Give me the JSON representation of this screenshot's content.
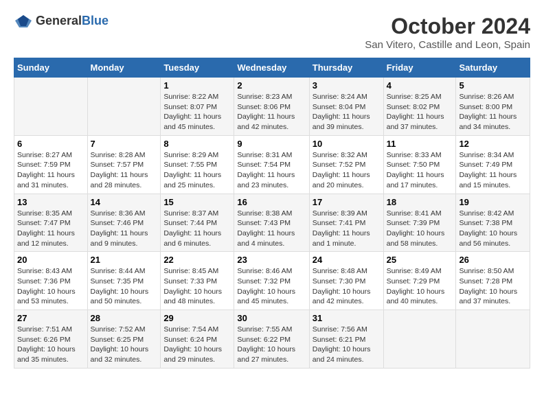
{
  "logo": {
    "text_general": "General",
    "text_blue": "Blue"
  },
  "title": "October 2024",
  "subtitle": "San Vitero, Castille and Leon, Spain",
  "days_of_week": [
    "Sunday",
    "Monday",
    "Tuesday",
    "Wednesday",
    "Thursday",
    "Friday",
    "Saturday"
  ],
  "weeks": [
    [
      {
        "day": "",
        "info": ""
      },
      {
        "day": "",
        "info": ""
      },
      {
        "day": "1",
        "info": "Sunrise: 8:22 AM\nSunset: 8:07 PM\nDaylight: 11 hours and 45 minutes."
      },
      {
        "day": "2",
        "info": "Sunrise: 8:23 AM\nSunset: 8:06 PM\nDaylight: 11 hours and 42 minutes."
      },
      {
        "day": "3",
        "info": "Sunrise: 8:24 AM\nSunset: 8:04 PM\nDaylight: 11 hours and 39 minutes."
      },
      {
        "day": "4",
        "info": "Sunrise: 8:25 AM\nSunset: 8:02 PM\nDaylight: 11 hours and 37 minutes."
      },
      {
        "day": "5",
        "info": "Sunrise: 8:26 AM\nSunset: 8:00 PM\nDaylight: 11 hours and 34 minutes."
      }
    ],
    [
      {
        "day": "6",
        "info": "Sunrise: 8:27 AM\nSunset: 7:59 PM\nDaylight: 11 hours and 31 minutes."
      },
      {
        "day": "7",
        "info": "Sunrise: 8:28 AM\nSunset: 7:57 PM\nDaylight: 11 hours and 28 minutes."
      },
      {
        "day": "8",
        "info": "Sunrise: 8:29 AM\nSunset: 7:55 PM\nDaylight: 11 hours and 25 minutes."
      },
      {
        "day": "9",
        "info": "Sunrise: 8:31 AM\nSunset: 7:54 PM\nDaylight: 11 hours and 23 minutes."
      },
      {
        "day": "10",
        "info": "Sunrise: 8:32 AM\nSunset: 7:52 PM\nDaylight: 11 hours and 20 minutes."
      },
      {
        "day": "11",
        "info": "Sunrise: 8:33 AM\nSunset: 7:50 PM\nDaylight: 11 hours and 17 minutes."
      },
      {
        "day": "12",
        "info": "Sunrise: 8:34 AM\nSunset: 7:49 PM\nDaylight: 11 hours and 15 minutes."
      }
    ],
    [
      {
        "day": "13",
        "info": "Sunrise: 8:35 AM\nSunset: 7:47 PM\nDaylight: 11 hours and 12 minutes."
      },
      {
        "day": "14",
        "info": "Sunrise: 8:36 AM\nSunset: 7:46 PM\nDaylight: 11 hours and 9 minutes."
      },
      {
        "day": "15",
        "info": "Sunrise: 8:37 AM\nSunset: 7:44 PM\nDaylight: 11 hours and 6 minutes."
      },
      {
        "day": "16",
        "info": "Sunrise: 8:38 AM\nSunset: 7:43 PM\nDaylight: 11 hours and 4 minutes."
      },
      {
        "day": "17",
        "info": "Sunrise: 8:39 AM\nSunset: 7:41 PM\nDaylight: 11 hours and 1 minute."
      },
      {
        "day": "18",
        "info": "Sunrise: 8:41 AM\nSunset: 7:39 PM\nDaylight: 10 hours and 58 minutes."
      },
      {
        "day": "19",
        "info": "Sunrise: 8:42 AM\nSunset: 7:38 PM\nDaylight: 10 hours and 56 minutes."
      }
    ],
    [
      {
        "day": "20",
        "info": "Sunrise: 8:43 AM\nSunset: 7:36 PM\nDaylight: 10 hours and 53 minutes."
      },
      {
        "day": "21",
        "info": "Sunrise: 8:44 AM\nSunset: 7:35 PM\nDaylight: 10 hours and 50 minutes."
      },
      {
        "day": "22",
        "info": "Sunrise: 8:45 AM\nSunset: 7:33 PM\nDaylight: 10 hours and 48 minutes."
      },
      {
        "day": "23",
        "info": "Sunrise: 8:46 AM\nSunset: 7:32 PM\nDaylight: 10 hours and 45 minutes."
      },
      {
        "day": "24",
        "info": "Sunrise: 8:48 AM\nSunset: 7:30 PM\nDaylight: 10 hours and 42 minutes."
      },
      {
        "day": "25",
        "info": "Sunrise: 8:49 AM\nSunset: 7:29 PM\nDaylight: 10 hours and 40 minutes."
      },
      {
        "day": "26",
        "info": "Sunrise: 8:50 AM\nSunset: 7:28 PM\nDaylight: 10 hours and 37 minutes."
      }
    ],
    [
      {
        "day": "27",
        "info": "Sunrise: 7:51 AM\nSunset: 6:26 PM\nDaylight: 10 hours and 35 minutes."
      },
      {
        "day": "28",
        "info": "Sunrise: 7:52 AM\nSunset: 6:25 PM\nDaylight: 10 hours and 32 minutes."
      },
      {
        "day": "29",
        "info": "Sunrise: 7:54 AM\nSunset: 6:24 PM\nDaylight: 10 hours and 29 minutes."
      },
      {
        "day": "30",
        "info": "Sunrise: 7:55 AM\nSunset: 6:22 PM\nDaylight: 10 hours and 27 minutes."
      },
      {
        "day": "31",
        "info": "Sunrise: 7:56 AM\nSunset: 6:21 PM\nDaylight: 10 hours and 24 minutes."
      },
      {
        "day": "",
        "info": ""
      },
      {
        "day": "",
        "info": ""
      }
    ]
  ]
}
